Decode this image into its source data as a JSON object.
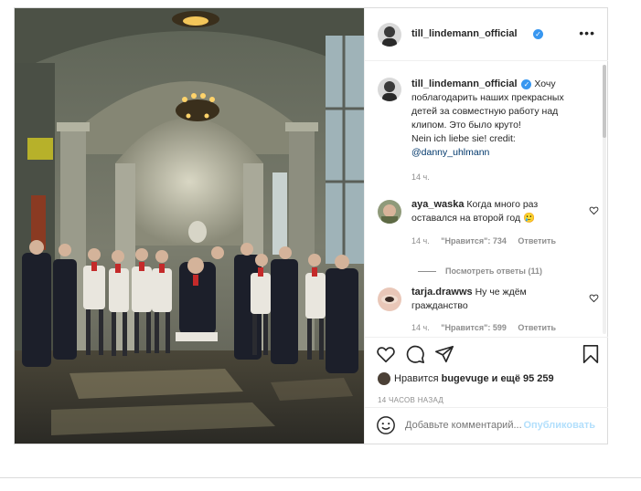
{
  "post": {
    "author": "till_lindemann_official",
    "verified": true,
    "more_icon": "more-horizontal-icon"
  },
  "caption": {
    "username": "till_lindemann_official",
    "text_line1": "Хочу",
    "text_line2": "поблагодарить наших прекрасных",
    "text_line3": "детей за совместную работу над",
    "text_line4": "клипом. Это было круто!",
    "text_line5": "Nein ich liebe sie! credit:",
    "mention": "@danny_uhlmann",
    "time": "14 ч."
  },
  "comments": [
    {
      "username": "aya_waska",
      "text_line1": "Когда много раз",
      "text_line2": "оставался на второй год 🥲",
      "time": "14 ч.",
      "likes": "\"Нравится\": 734",
      "reply": "Ответить",
      "view_replies": "Посмотреть ответы (11)"
    },
    {
      "username": "tarja.drawws",
      "text_line1": "Ну че ждём",
      "text_line2": "гражданство",
      "time": "14 ч.",
      "likes": "\"Нравится\": 599",
      "reply": "Ответить"
    }
  ],
  "actions": {
    "icons": [
      "heart-icon",
      "comment-icon",
      "share-icon",
      "bookmark-icon"
    ],
    "likes_prefix": "Нравится",
    "likes_user": "bugevuge",
    "likes_suffix": "и ещё 95 259",
    "timestamp": "14 ЧАСОВ НАЗАД"
  },
  "add_comment": {
    "placeholder": "Добавьте комментарий...",
    "publish": "Опубликовать"
  },
  "colors": {
    "accent": "#3897f0",
    "publish_disabled": "#b2dffc",
    "border": "#dbdbdb",
    "muted": "#8e8e8e"
  }
}
